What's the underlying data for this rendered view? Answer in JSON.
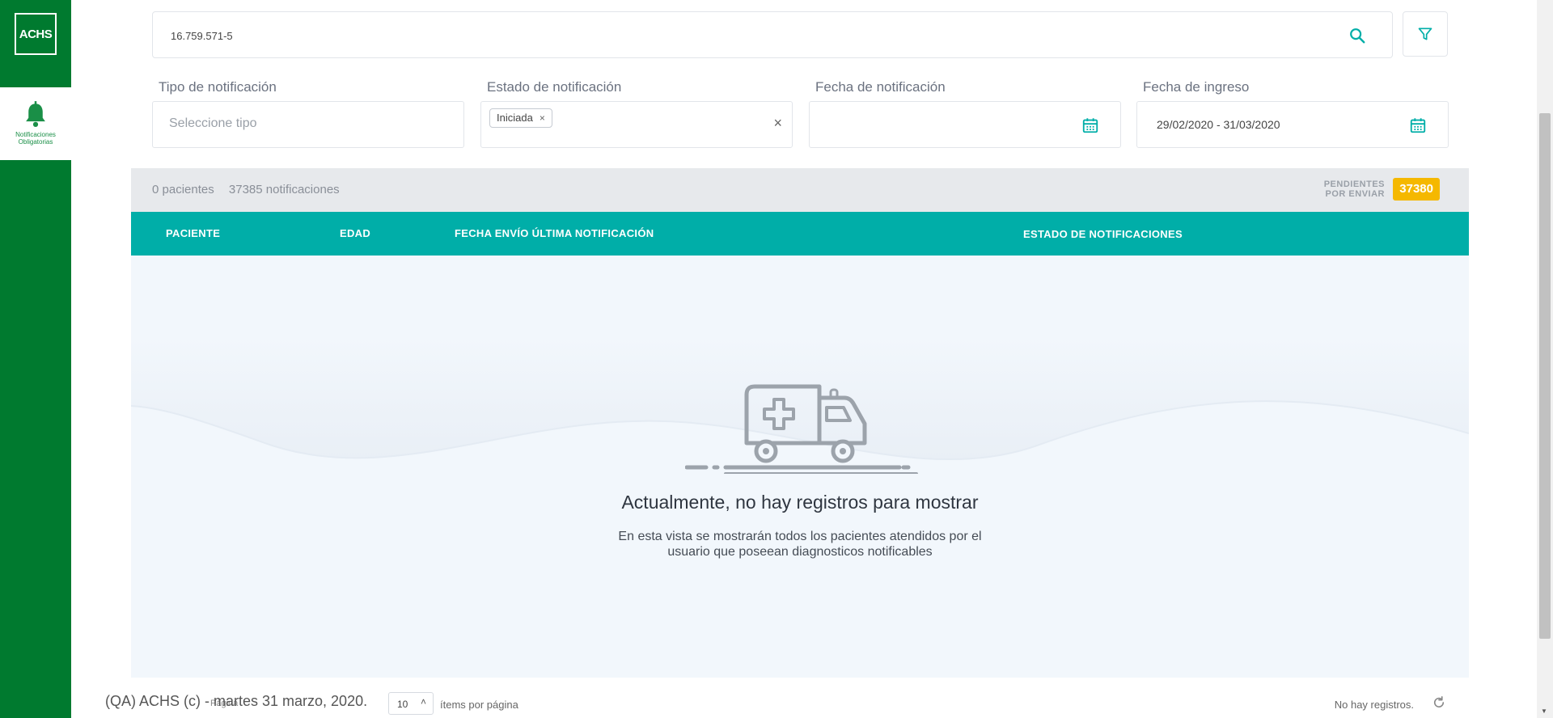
{
  "sidebar": {
    "logo_text": "ACHS",
    "nav_item_label_1": "Notificaciones",
    "nav_item_label_2": "Obligatorias"
  },
  "search": {
    "value": "16.759.571-5"
  },
  "filters": {
    "tipo_label": "Tipo de notificación",
    "tipo_placeholder": "Seleccione tipo",
    "estado_label": "Estado de notificación",
    "estado_chip": "Iniciada",
    "fecha_notif_label": "Fecha de notificación",
    "fecha_ingreso_label": "Fecha de ingreso",
    "fecha_ingreso_value": "29/02/2020 - 31/03/2020"
  },
  "stats": {
    "pacientes": "0 pacientes",
    "notificaciones": "37385 notificaciones",
    "pendientes_line1": "PENDIENTES",
    "pendientes_line2": "POR ENVIAR",
    "pendientes_count": "37380"
  },
  "table": {
    "columns": [
      "PACIENTE",
      "EDAD",
      "FECHA ENVÍO ÚLTIMA NOTIFICACIÓN",
      "ESTADO DE NOTIFICACIONES"
    ]
  },
  "empty": {
    "title": "Actualmente, no hay registros para mostrar",
    "desc_line1": "En esta vista se mostrarán todos los pacientes atendidos por el",
    "desc_line2": "usuario que poseean diagnosticos notificables"
  },
  "footer": {
    "pagina": "Página",
    "page_size": "10",
    "per_page": "ítems por página",
    "no_registros": "No hay registros."
  },
  "copyright": "(QA) ACHS (c) - martes 31 marzo, 2020.",
  "colors": {
    "brand_green": "#007a2f",
    "teal": "#00aea8",
    "badge_yellow": "#f5b800"
  }
}
